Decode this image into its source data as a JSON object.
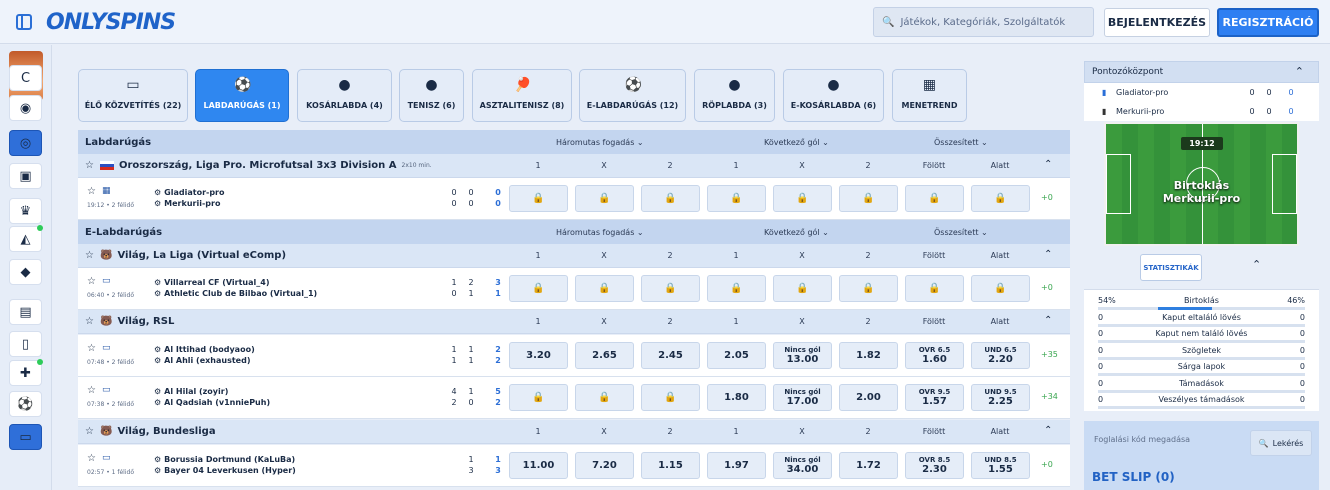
{
  "header": {
    "logo": "ONLYSPINS",
    "search_placeholder": "Játékok, Kategóriák, Szolgáltatók",
    "login": "BEJELENTKEZÉS",
    "register": "REGISZTRÁCIÓ"
  },
  "rail": [
    "c-icon",
    "firefox-icon",
    "egg-icon",
    "gift-icon",
    "trophy-icon",
    "pizza-icon",
    "gem-icon",
    "slot-icon",
    "phone-icon",
    "puzzle-icon",
    "soccer-icon",
    "tv-icon"
  ],
  "tabs": [
    {
      "label": "ÉLŐ KÖZVETÍTÉS (22)",
      "icon": "▭"
    },
    {
      "label": "LABDARÚGÁS (1)",
      "icon": "⚽"
    },
    {
      "label": "KOSÁRLABDA (4)",
      "icon": "●"
    },
    {
      "label": "TENISZ (6)",
      "icon": "●"
    },
    {
      "label": "ASZTALITENISZ (8)",
      "icon": "🏓"
    },
    {
      "label": "E-LABDARÚGÁS (12)",
      "icon": "⚽"
    },
    {
      "label": "RÖPLABDA (3)",
      "icon": "●"
    },
    {
      "label": "E-KOSÁRLABDA (6)",
      "icon": "●"
    },
    {
      "label": "MENETREND",
      "icon": "▦"
    }
  ],
  "markets": {
    "m1": "Háromutas fogadás ⌄",
    "m2": "Következő gól ⌄",
    "m3": "Összesített ⌄"
  },
  "cols": [
    "1",
    "X",
    "2",
    "1",
    "X",
    "2",
    "Fölött",
    "Alatt"
  ],
  "sections": [
    {
      "name": "Labdarúgás"
    },
    {
      "name": "E-Labdarúgás"
    }
  ],
  "leagues": [
    {
      "name": "Oroszország, Liga Pro. Microfutsal 3x3 Division A",
      "sub": "2x10 min.",
      "flag": "russia"
    },
    {
      "name": "Világ, La Liga (Virtual eComp)",
      "sub": ""
    },
    {
      "name": "Világ, RSL",
      "sub": ""
    },
    {
      "name": "Világ, Bundesliga",
      "sub": ""
    }
  ],
  "matches": [
    {
      "t1": "Gladiator-pro",
      "t2": "Merkurii-pro",
      "time": "19:12 • 2 félidő",
      "s1": [
        "0",
        "0",
        "0"
      ],
      "s2": [
        "0",
        "0",
        "0"
      ],
      "odds": [
        "",
        "",
        "",
        "",
        "",
        "",
        "",
        ""
      ],
      "more": "+0"
    },
    {
      "t1": "Villarreal CF (Virtual_4)",
      "t2": "Athletic Club de Bilbao (Virtual_1)",
      "time": "06:40 • 2 félidő",
      "s1": [
        "1",
        "2",
        "3"
      ],
      "s2": [
        "0",
        "1",
        "1"
      ],
      "odds": [
        "",
        "",
        "",
        "",
        "",
        "",
        "",
        ""
      ],
      "more": "+0"
    },
    {
      "t1": "Al Ittihad (bodyaoo)",
      "t2": "Al Ahli (exhausted)",
      "time": "07:48 • 2 félidő",
      "s1": [
        "1",
        "1",
        "2"
      ],
      "s2": [
        "1",
        "1",
        "2"
      ],
      "odds": [
        "3.20",
        "2.65",
        "2.45",
        "2.05",
        "Nincs gól|13.00",
        "1.82",
        "OVR 6.5|1.60",
        "UND 6.5|2.20"
      ],
      "more": "+35"
    },
    {
      "t1": "Al Hilal (zoyir)",
      "t2": "Al Qadsiah (v1nniePuh)",
      "time": "07:38 • 2 félidő",
      "s1": [
        "4",
        "1",
        "5"
      ],
      "s2": [
        "2",
        "0",
        "2"
      ],
      "odds": [
        "",
        "",
        "",
        "1.80",
        "Nincs gól|17.00",
        "2.00",
        "OVR 9.5|1.57",
        "UND 9.5|2.25"
      ],
      "more": "+34"
    },
    {
      "t1": "Borussia Dortmund (KaLuBa)",
      "t2": "Bayer 04 Leverkusen (Hyper)",
      "time": "02:57 • 1 félidő",
      "s1": [
        "",
        "1",
        "1"
      ],
      "s2": [
        "",
        "3",
        "3"
      ],
      "odds": [
        "11.00",
        "7.20",
        "1.15",
        "1.97",
        "Nincs gól|34.00",
        "1.72",
        "OVR 8.5|2.30",
        "UND 8.5|1.55"
      ],
      "more": "+0"
    }
  ],
  "scorecenter": {
    "title": "Pontozóközpont",
    "rows": [
      {
        "name": "Gladiator-pro",
        "a": "0",
        "b": "0",
        "c": "0"
      },
      {
        "name": "Merkurii-pro",
        "a": "0",
        "b": "0",
        "c": "0"
      }
    ],
    "clock": "19:12",
    "possession": "Birtoklás\nMerkurii-pro"
  },
  "stats_button": "STATISZTIKÁK",
  "stats": [
    {
      "l": "54%",
      "c": "Birtoklás",
      "r": "46%",
      "fill": 0.54
    },
    {
      "l": "0",
      "c": "Kaput eltaláló lövés",
      "r": "0",
      "fill": 0
    },
    {
      "l": "0",
      "c": "Kaput nem találó lövés",
      "r": "0",
      "fill": 0
    },
    {
      "l": "0",
      "c": "Szögletek",
      "r": "0",
      "fill": 0
    },
    {
      "l": "0",
      "c": "Sárga lapok",
      "r": "0",
      "fill": 0
    },
    {
      "l": "0",
      "c": "Támadások",
      "r": "0",
      "fill": 0
    },
    {
      "l": "0",
      "c": "Veszélyes támadások",
      "r": "0",
      "fill": 0
    }
  ],
  "betslip": {
    "code_placeholder": "Foglalási kód megadása",
    "lookup": "Lekérés",
    "title": "BET SLIP (0)"
  }
}
